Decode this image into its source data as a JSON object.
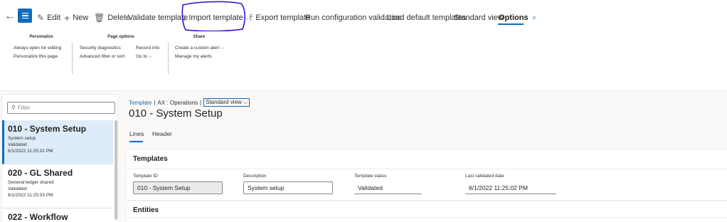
{
  "toolbar": {
    "edit": "Edit",
    "new": "New",
    "delete": "Delete",
    "validate_template": "Validate template",
    "import_template": "Import template",
    "export_template": "Export template",
    "run_config_validation": "Run configuration validation",
    "load_default_templates": "Load default templates",
    "standard_view": "Standard view",
    "options": "Options"
  },
  "ribbon": {
    "personalize": {
      "title": "Personalize",
      "items": [
        "Always open for editing",
        "Personalize this page"
      ]
    },
    "page_options": {
      "title": "Page options",
      "security_diagnostics": "Security diagnostics",
      "record_info": "Record info",
      "advanced_filter": "Advanced filter or sort",
      "go_to": "Go to"
    },
    "share": {
      "title": "Share",
      "items": [
        "Create a custom alert",
        "Manage my alerts"
      ]
    }
  },
  "left_panel": {
    "filter_placeholder": "Filter",
    "items": [
      {
        "title": "010 - System Setup",
        "desc": "System setup",
        "status": "Validated",
        "date": "6/1/2022 11:25:02 PM",
        "selected": true
      },
      {
        "title": "020 - GL Shared",
        "desc": "General ledger shared",
        "status": "Validated",
        "date": "6/1/2022 11:25:03 PM",
        "selected": false
      },
      {
        "title": "022 - Workflow",
        "desc": "",
        "status": "",
        "date": "",
        "selected": false
      }
    ]
  },
  "main": {
    "breadcrumb": {
      "link": "Template",
      "sep1": "|",
      "company": "AX : Operations",
      "sep2": "|",
      "view": "Standard view"
    },
    "title": "010 - System Setup",
    "tabs": [
      "Lines",
      "Header"
    ],
    "templates_section": {
      "title": "Templates",
      "fields": [
        {
          "label": "Template ID",
          "value": "010 - System Setup"
        },
        {
          "label": "Description",
          "value": "System setup"
        },
        {
          "label": "Template status",
          "value": "Validated"
        },
        {
          "label": "Last validated date",
          "value": "6/1/2022 11:25:02 PM"
        }
      ]
    },
    "entities_section": {
      "title": "Entities"
    }
  },
  "colors": {
    "accent": "#0f6cbd",
    "annotation": "#1f10c8",
    "selected_bg": "#deecf9"
  }
}
